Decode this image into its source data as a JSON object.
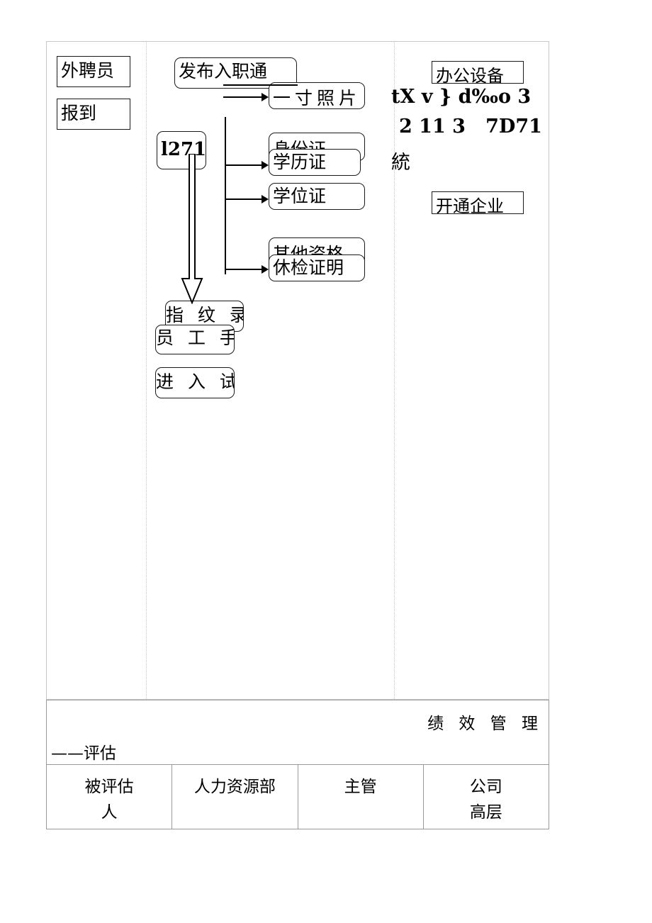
{
  "document": {
    "page_background": "#ffffff",
    "frame_border_color": "#c9c9c9",
    "node_border_color": "#1a1a1a"
  },
  "flow": {
    "lanes": [
      {
        "id": "lane-left",
        "label": ""
      },
      {
        "id": "lane-middle",
        "label": ""
      },
      {
        "id": "lane-right",
        "label": ""
      }
    ],
    "left_column": {
      "nodes": [
        {
          "id": "node-waipin-yuan",
          "text": "外聘员",
          "shape": "rect"
        },
        {
          "id": "node-baodao",
          "text": "报到",
          "shape": "rect"
        }
      ]
    },
    "middle_column": {
      "nodes": [
        {
          "id": "node-fabu-ruzhi-tong",
          "text": "发布入职通",
          "shape": "round"
        },
        {
          "id": "node-yicun-zhaopian",
          "text": "一寸照片",
          "shape": "round"
        },
        {
          "id": "node-1271",
          "text": "l271",
          "shape": "round"
        },
        {
          "id": "node-shenfenzheng",
          "text": "身份证",
          "shape": "round"
        },
        {
          "id": "node-xuelizheng",
          "text": "学历证",
          "shape": "round"
        },
        {
          "id": "node-xueweizheng",
          "text": "学位证",
          "shape": "round"
        },
        {
          "id": "node-qita-zige",
          "text": "其他资格",
          "shape": "round"
        },
        {
          "id": "node-tijian-zhengming",
          "text": "休检证明",
          "shape": "round"
        },
        {
          "id": "node-zhiwen-lu",
          "text": "指 纹 录",
          "shape": "round"
        },
        {
          "id": "node-yuangong-shou",
          "text": "员 工 手",
          "shape": "round"
        },
        {
          "id": "node-jinru-shi",
          "text": "进 入 试",
          "shape": "round"
        }
      ]
    },
    "right_column": {
      "nodes": [
        {
          "id": "node-bangong-shebei",
          "text": "办公设备",
          "shape": "rect"
        },
        {
          "id": "node-kaitong-qiye",
          "text": "开通企业",
          "shape": "rect"
        }
      ],
      "raw_text_lines": [
        {
          "id": "raw-line-1",
          "text": "tX v } d‰o 3"
        },
        {
          "id": "raw-line-2",
          "text": "2 11 3   7D71"
        },
        {
          "id": "raw-line-3",
          "text": "統"
        }
      ]
    }
  },
  "bottom_table": {
    "title_primary": "绩 效 管 理",
    "title_secondary": "——评估",
    "role_row": [
      {
        "id": "role-assessee",
        "text": "被评估\n人"
      },
      {
        "id": "role-hr",
        "text": "人力资源部"
      },
      {
        "id": "role-manager",
        "text": "主管"
      },
      {
        "id": "role-executive",
        "text": "公司\n高层"
      }
    ]
  }
}
